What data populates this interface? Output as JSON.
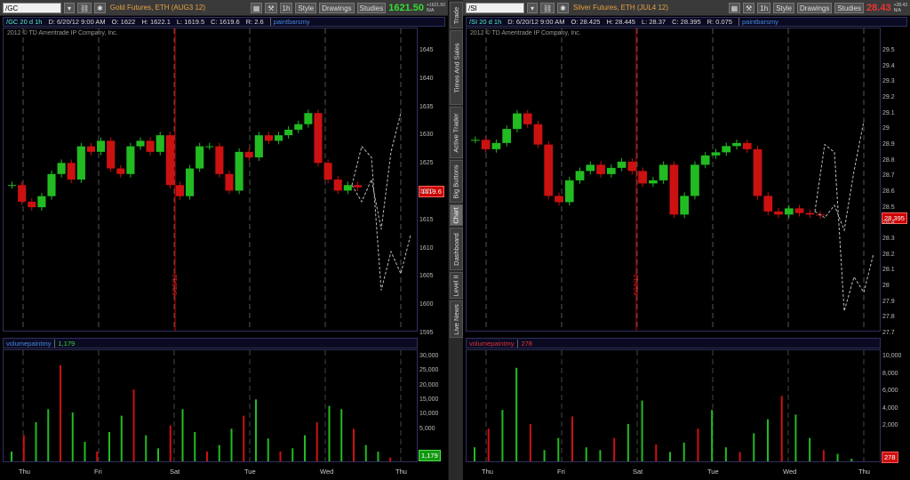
{
  "sidebar": {
    "tabs": [
      {
        "label": "Trade",
        "top": 2,
        "height": 30,
        "active": false
      },
      {
        "label": "Times And Sales",
        "top": 34,
        "height": 84,
        "active": false
      },
      {
        "label": "Active Trader",
        "top": 120,
        "height": 58,
        "active": false
      },
      {
        "label": "Big Buttons",
        "top": 180,
        "height": 48,
        "active": false
      },
      {
        "label": "Chart",
        "top": 230,
        "height": 24,
        "active": true
      },
      {
        "label": "Dashboard",
        "top": 256,
        "height": 48,
        "active": false
      },
      {
        "label": "Level II",
        "top": 306,
        "height": 30,
        "active": false
      },
      {
        "label": "Live News",
        "top": 338,
        "height": 42,
        "active": false
      }
    ]
  },
  "panels": [
    {
      "id": "left",
      "toolbar": {
        "symbol": "/GC",
        "description": "Gold Futures, ETH (AUG3 12)",
        "period": "1h",
        "style_label": "Style",
        "drawings_label": "Drawings",
        "studies_label": "Studies",
        "price": "1621.50",
        "price_color": "#33dd33",
        "price_sub_1": "+1621.50",
        "price_sub_2": "N/A"
      },
      "infobar": {
        "symbol": "/GC 20 d 1h",
        "date": "D: 6/20/12 9:00 AM",
        "open": "O: 1622",
        "high": "H: 1622.1",
        "low": "L: 1619.5",
        "close": "C: 1619.6",
        "range": "R: 2.6",
        "study": "paintbarsmy"
      },
      "copyright": "2012 © TD Ameritrade IP Company, Inc.",
      "volume": {
        "name": "volumepaintmy",
        "value": "1,179",
        "value_color": "#33dd33",
        "tag": "1,179",
        "tag_color": "#119911"
      },
      "price_tag": "1619.6",
      "date_marker": "6/15/12",
      "y_ticks": [
        "1645",
        "1640",
        "1635",
        "1630",
        "1625",
        "1620",
        "1615",
        "1610",
        "1605",
        "1600",
        "1595"
      ],
      "vol_ticks": [
        "30,000",
        "25,000",
        "20,000",
        "15,000",
        "10,000",
        "5,000"
      ],
      "x_ticks": [
        "Thu",
        "Fri",
        "Sat",
        "Tue",
        "Wed",
        "Thu"
      ]
    },
    {
      "id": "right",
      "toolbar": {
        "symbol": "/SI",
        "description": "Silver Futures, ETH (JUL4 12)",
        "period": "1h",
        "style_label": "Style",
        "drawings_label": "Drawings",
        "studies_label": "Studies",
        "price": "28.43",
        "price_color": "#ee3333",
        "price_sub_1": "+28.43",
        "price_sub_2": "N/A"
      },
      "infobar": {
        "symbol": "/SI 20 d 1h",
        "date": "D: 6/20/12 9:00 AM",
        "open": "O: 28.425",
        "high": "H: 28.445",
        "low": "L: 28.37",
        "close": "C: 28.395",
        "range": "R: 0.075",
        "study": "paintbarsmy"
      },
      "copyright": "2012 © TD Ameritrade IP Company, Inc.",
      "volume": {
        "name": "volumepaintmy",
        "value": "278",
        "value_color": "#ee3333",
        "tag": "278",
        "tag_color": "#cc1111"
      },
      "price_tag": "28.395",
      "date_marker": "6/15/12",
      "y_ticks": [
        "29.5",
        "29.4",
        "29.3",
        "29.2",
        "29.1",
        "29",
        "28.9",
        "28.8",
        "28.7",
        "28.6",
        "28.5",
        "28.4",
        "28.3",
        "28.2",
        "28.1",
        "28",
        "27.9",
        "27.8",
        "27.7"
      ],
      "vol_ticks": [
        "10,000",
        "8,000",
        "6,000",
        "4,000",
        "2,000"
      ],
      "x_ticks": [
        "Thu",
        "Fri",
        "Sat",
        "Tue",
        "Wed",
        "Thu"
      ]
    }
  ],
  "chart_data": [
    {
      "type": "candlestick",
      "title": "Gold Futures, ETH (AUG3 12)",
      "ylim": [
        1595,
        1647
      ],
      "x_labels": [
        "Thu",
        "Fri",
        "Sat",
        "Tue",
        "Wed",
        "Thu"
      ],
      "values": [
        1620,
        1617,
        1616,
        1618,
        1622,
        1624,
        1621,
        1627,
        1626,
        1628,
        1623,
        1622,
        1627,
        1628,
        1626,
        1629,
        1620,
        1618,
        1623,
        1627,
        1627,
        1622,
        1619,
        1626,
        1625,
        1629,
        1628,
        1629,
        1630,
        1631,
        1633,
        1624,
        1621,
        1619,
        1620,
        1619.6
      ],
      "series": [
        {
          "name": "projection",
          "values": [
            1620,
            1617,
            1621,
            1612,
            1626,
            1633,
            1627,
            1625,
            1601,
            1608,
            1604,
            1611
          ]
        }
      ],
      "volume": [
        3000,
        8000,
        12000,
        16000,
        29500,
        15000,
        6000,
        3000,
        9000,
        14000,
        22000,
        8000,
        4000,
        11000,
        16000,
        9000,
        3000,
        5000,
        10000,
        14000,
        19000,
        7000,
        3000,
        4000,
        8000,
        12000,
        17000,
        16000,
        10000,
        5000,
        3000,
        1179
      ]
    },
    {
      "type": "candlestick",
      "title": "Silver Futures, ETH (JUL4 12)",
      "ylim": [
        27.7,
        29.55
      ],
      "x_labels": [
        "Thu",
        "Fri",
        "Sat",
        "Tue",
        "Wed",
        "Thu"
      ],
      "values": [
        28.88,
        28.82,
        28.86,
        28.95,
        29.05,
        28.98,
        28.85,
        28.52,
        28.48,
        28.62,
        28.68,
        28.72,
        28.66,
        28.7,
        28.74,
        28.68,
        28.6,
        28.62,
        28.72,
        28.4,
        28.52,
        28.72,
        28.78,
        28.8,
        28.84,
        28.86,
        28.82,
        28.52,
        28.42,
        28.4,
        28.44,
        28.41,
        28.4,
        28.395
      ],
      "series": [
        {
          "name": "projection",
          "values": [
            28.42,
            28.38,
            28.46,
            28.3,
            28.68,
            29.0,
            28.85,
            28.8,
            27.78,
            28.0,
            27.9,
            28.15
          ]
        }
      ],
      "volume": [
        1500,
        3500,
        5500,
        10000,
        4000,
        1200,
        2500,
        4800,
        1500,
        1200,
        2500,
        4000,
        6500,
        1800,
        1000,
        2000,
        3500,
        5500,
        1500,
        1000,
        3000,
        4500,
        7000,
        5000,
        2500,
        1200,
        800,
        278
      ]
    }
  ]
}
